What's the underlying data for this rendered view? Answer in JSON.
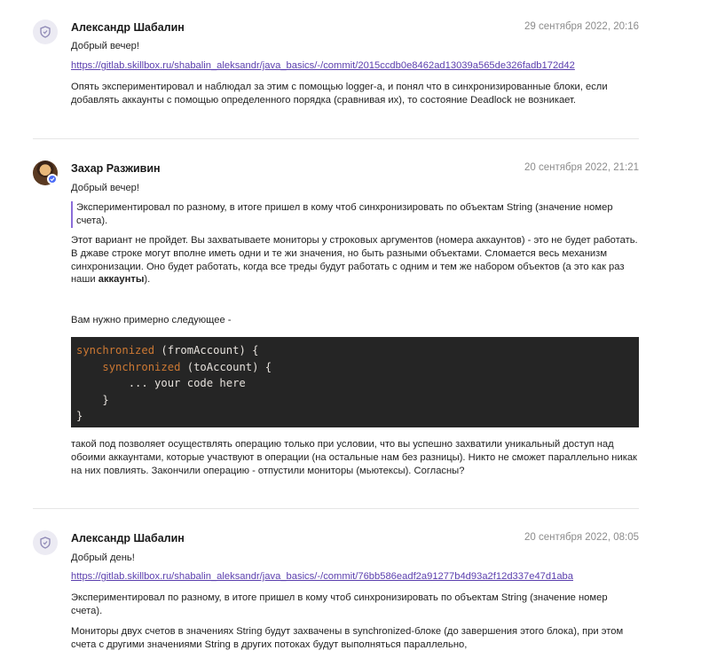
{
  "messages": [
    {
      "author": "Александр Шабалин",
      "date": "29 сентября 2022, 20:16",
      "greeting": "Добрый вечер!",
      "link": "https://gitlab.skillbox.ru/shabalin_aleksandr/java_basics/-/commit/2015ccdb0e8462ad13039a565de326fadb172d42",
      "text": "Опять экспериментировал и наблюдал за этим с помощью logger-а, и понял что в синхронизированные блоки, если добавлять аккаунты с помощью определенного порядка (сравнивая их), то состояние Deadlock не возникает.",
      "avatar_icon": "shield-icon"
    },
    {
      "author": "Захар Разживин",
      "date": "20 сентября 2022, 21:21",
      "greeting": "Добрый вечер!",
      "quote": "Экспериментировал по разному, в итоге пришел в кому чтоб синхронизировать по объектам String (значение номер счета).",
      "text_main": "Этот вариант не пройдет. Вы захватываете мониторы у строковых аргументов (номера аккаунтов) - это не будет работать. В джаве строке могут вполне иметь одни и те жи значения, но быть разными объектами. Сломается весь механизм синхронизации. Оно будет работать, когда все треды будут работать с одним и тем же набором объектов (а это как раз наши ",
      "text_bold": "аккаунты",
      "text_end": ").",
      "intro": "Вам нужно примерно следующее -",
      "code": {
        "kw1": "synchronized",
        "line1_rest": " (fromAccount) {",
        "kw2": "synchronized",
        "line2_rest": " (toAccount) {",
        "line3": "        ... your code here",
        "line4": "    }",
        "line5": "}"
      },
      "after": "такой под позволяет осуществлять операцию только при условии, что вы успешно захватили уникальный доступ над обоими аккаунтами, которые участвуют в операции (на остальные нам без разницы). Никто не сможет параллельно никак на них повлиять. Закончили операцию - отпустили мониторы (мьютексы). Согласны?",
      "avatar_icon": "user-photo",
      "badge_icon": "verified-check-icon"
    },
    {
      "author": "Александр Шабалин",
      "date": "20 сентября 2022, 08:05",
      "greeting": "Добрый день!",
      "link": "https://gitlab.skillbox.ru/shabalin_aleksandr/java_basics/-/commit/76bb586eadf2a91277b4d93a2f12d337e47d1aba",
      "text1": "Экспериментировал по разному, в итоге пришел в кому чтоб синхронизировать по объектам String (значение номер счета).",
      "text2": "Мониторы двух счетов в значениях String будут захвачены в  synchronized-блоке (до завершения этого блока), при этом счета с другими значениями String в других потоках будут выполняться параллельно,",
      "avatar_icon": "shield-icon"
    }
  ],
  "colors": {
    "link": "#5b3fae",
    "quote_bar": "#8b6dd9",
    "code_bg": "#252525",
    "code_keyword": "#cc7833",
    "badge": "#4a6cf7"
  }
}
